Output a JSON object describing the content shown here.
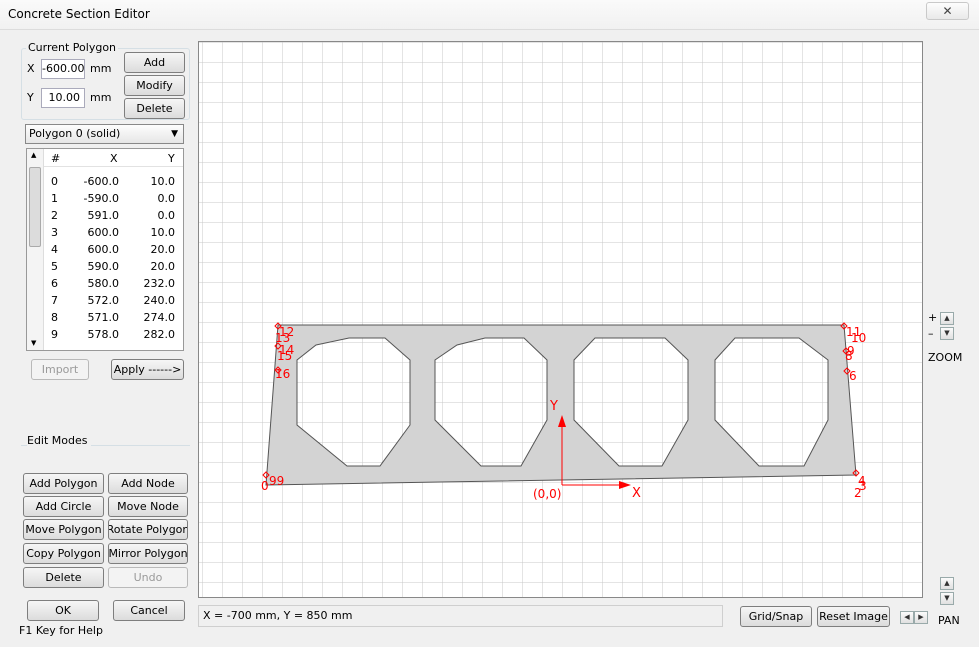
{
  "window": {
    "title": "Concrete Section Editor",
    "close_glyph": "✕"
  },
  "current_polygon": {
    "legend": "Current Polygon",
    "x_label": "X",
    "x_value": "-600.00",
    "x_unit": "mm",
    "y_label": "Y",
    "y_value": "10.00",
    "y_unit": "mm",
    "add_label": "Add",
    "modify_label": "Modify",
    "delete_label": "Delete"
  },
  "polygon_select": {
    "value": "Polygon 0 (solid)"
  },
  "nodes_table": {
    "headers": [
      "#",
      "X",
      "Y"
    ],
    "rows": [
      [
        "0",
        "-600.0",
        "10.0"
      ],
      [
        "1",
        "-590.0",
        "0.0"
      ],
      [
        "2",
        "591.0",
        "0.0"
      ],
      [
        "3",
        "600.0",
        "10.0"
      ],
      [
        "4",
        "600.0",
        "20.0"
      ],
      [
        "5",
        "590.0",
        "20.0"
      ],
      [
        "6",
        "580.0",
        "232.0"
      ],
      [
        "7",
        "572.0",
        "240.0"
      ],
      [
        "8",
        "571.0",
        "274.0"
      ],
      [
        "9",
        "578.0",
        "282.0"
      ]
    ]
  },
  "table_actions": {
    "import_label": "Import",
    "apply_label": "Apply ------>"
  },
  "edit_modes": {
    "legend": "Edit Modes",
    "buttons": [
      "Add Polygon",
      "Add Node",
      "Add Circle",
      "Move Node",
      "Move Polygon",
      "Rotate Polygon",
      "Copy Polygon",
      "Mirror Polygon",
      "Delete",
      "Undo"
    ]
  },
  "footer": {
    "ok_label": "OK",
    "cancel_label": "Cancel",
    "help_text": "F1 Key for Help"
  },
  "status": {
    "coords": "X = -700 mm, Y = 850 mm"
  },
  "view_controls": {
    "grid_snap_label": "Grid/Snap",
    "reset_image_label": "Reset Image",
    "zoom_label": "ZOOM",
    "zoom_plus": "+",
    "zoom_minus": "–",
    "pan_label": "PAN"
  },
  "canvas": {
    "origin_label": "(0,0)",
    "x_axis_label": "X",
    "y_axis_label": "Y",
    "accent_color": "#ff0000",
    "section_fill": "#d3d3d3",
    "node_labels_left": [
      "12",
      "13",
      "14",
      "15",
      "16",
      "0",
      "99"
    ],
    "node_labels_right": [
      "11",
      "10",
      "9",
      "8",
      "6",
      "4",
      "3",
      "2"
    ]
  }
}
